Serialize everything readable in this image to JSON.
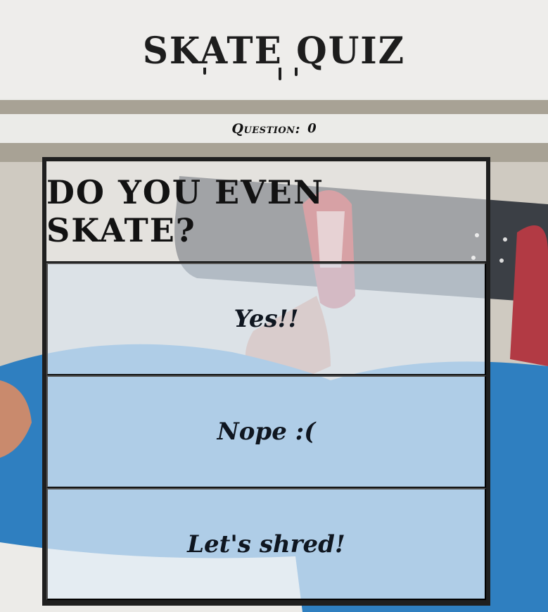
{
  "app": {
    "title": "SKATE QUIZ"
  },
  "counter": {
    "label": "Question:",
    "value": "0"
  },
  "quiz": {
    "question": "DO YOU EVEN SKATE?",
    "answers": [
      {
        "label": "Yes!!"
      },
      {
        "label": "Nope :("
      },
      {
        "label": "Let's shred!"
      }
    ]
  },
  "colors": {
    "panel": "#f0f0ee",
    "answer_tint": "#e1ebf5",
    "border": "#1f1f1f",
    "text": "#111111"
  }
}
